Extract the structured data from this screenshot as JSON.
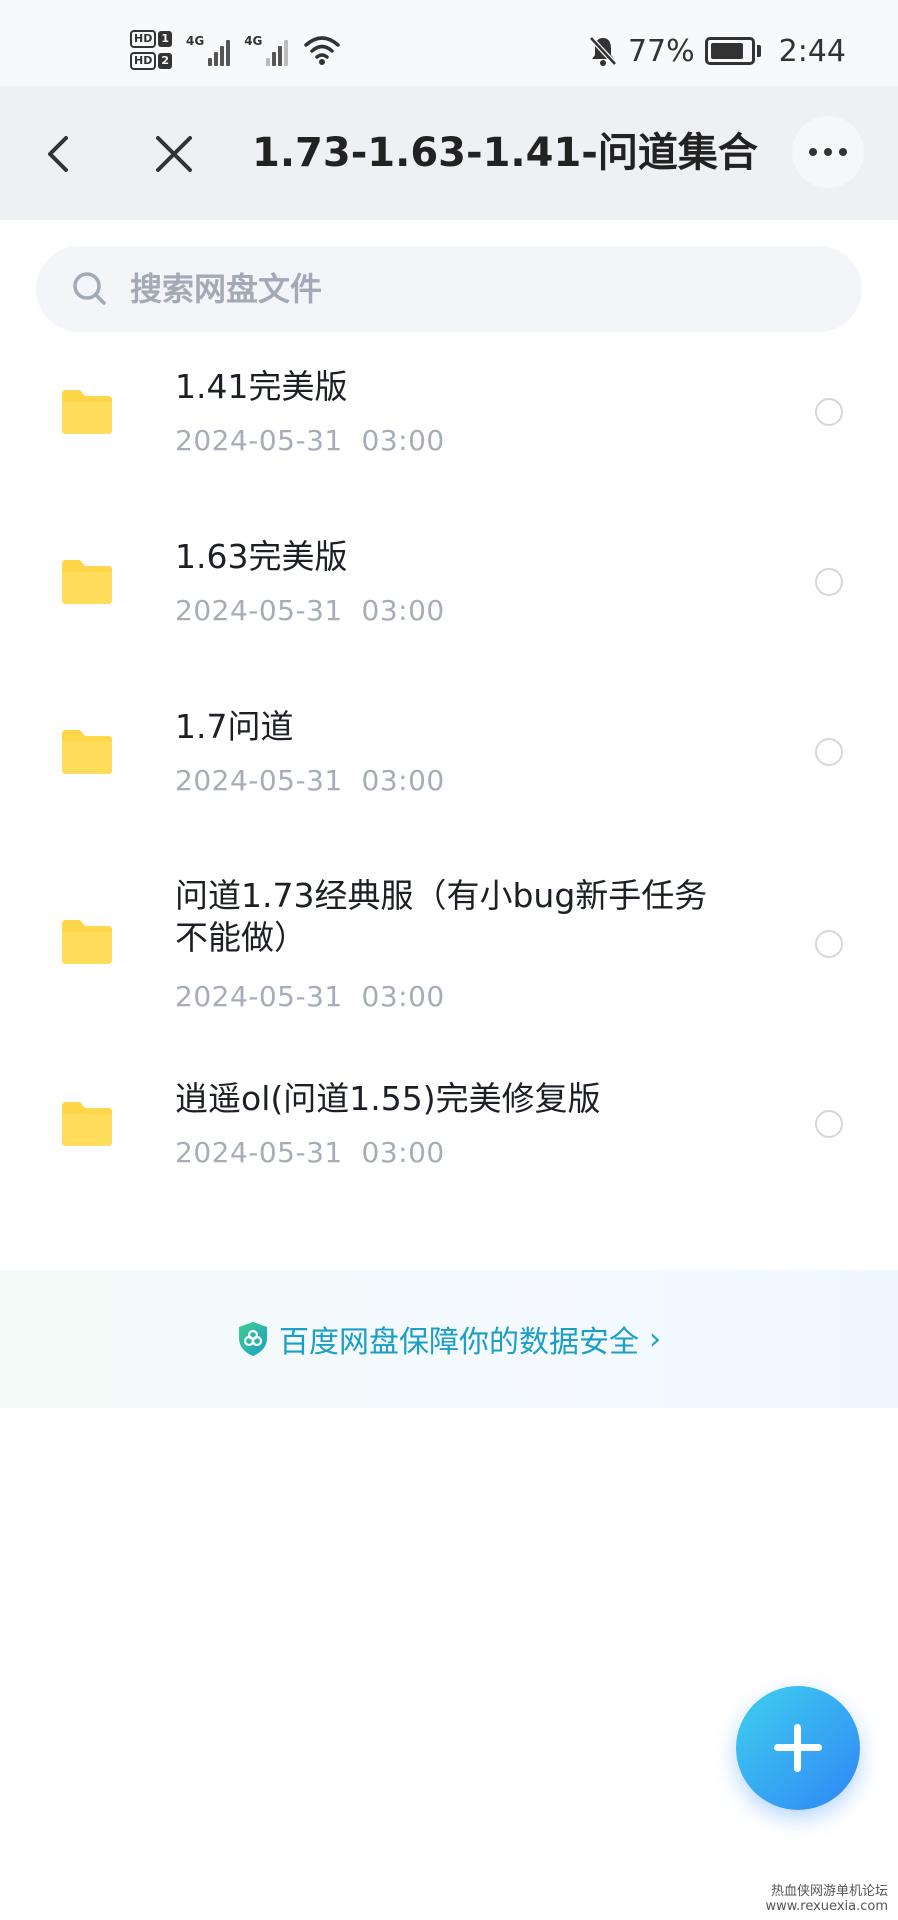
{
  "status_bar": {
    "sim1_label": "HD",
    "sim1_num": "1",
    "sim2_label": "HD",
    "sim2_num": "2",
    "network1": "4G",
    "network2": "4G",
    "battery": "77%",
    "time": "2:44",
    "icons": [
      "signal-icon",
      "wifi-icon",
      "mute-bell-icon",
      "battery-icon"
    ]
  },
  "header": {
    "title": "1.73-1.63-1.41-问道集合",
    "icons": [
      "back-arrow-icon",
      "close-icon",
      "more-icon"
    ]
  },
  "search": {
    "placeholder": "搜索网盘文件"
  },
  "files": [
    {
      "name": "1.41完美版",
      "date": "2024-05-31  03:00"
    },
    {
      "name": "1.63完美版",
      "date": "2024-05-31  03:00"
    },
    {
      "name": "1.7问道",
      "date": "2024-05-31  03:00"
    },
    {
      "name": "问道1.73经典服（有小bug新手任务不能做）",
      "date": "2024-05-31  03:00"
    },
    {
      "name": "逍遥ol(问道1.55)完美修复版",
      "date": "2024-05-31  03:00"
    }
  ],
  "banner": {
    "text": "百度网盘保障你的数据安全",
    "chevron": "›"
  },
  "colors": {
    "folder": "#ffd54a",
    "accent": "#1b9fc6",
    "fab_start": "#3fd0ef",
    "fab_end": "#2f86f5"
  },
  "watermark": {
    "line1": "热血侠网游单机论坛",
    "line2": "www.rexuexia.com"
  }
}
